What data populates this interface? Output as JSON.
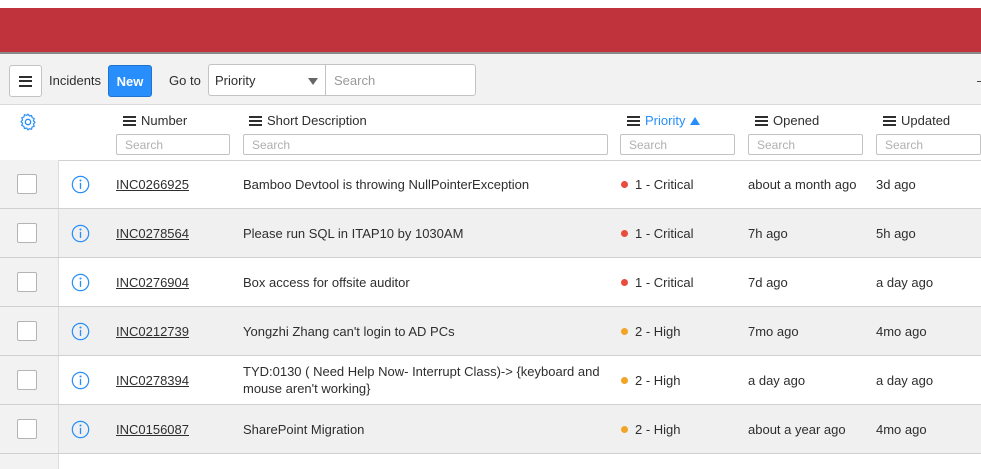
{
  "toolbar": {
    "title": "Incidents",
    "new_label": "New",
    "goto_label": "Go to",
    "goto_selected": "Priority",
    "search_placeholder": "Search"
  },
  "columns": {
    "number": "Number",
    "short_description": "Short Description",
    "priority": "Priority",
    "opened": "Opened",
    "updated": "Updated",
    "search_placeholder": "Search",
    "sorted_by": "Priority",
    "sort_direction": "ascending"
  },
  "colors": {
    "banner": "#c0333c",
    "accent": "#278efc",
    "critical": "#e84c3d",
    "high": "#f2a425"
  },
  "rows": [
    {
      "number": "INC0266925",
      "short_description": "Bamboo Devtool is throwing NullPointerException",
      "priority": "1 - Critical",
      "priority_level": "critical",
      "opened": "about a month ago",
      "updated": "3d ago"
    },
    {
      "number": "INC0278564",
      "short_description": "Please run SQL in ITAP10 by 1030AM",
      "priority": "1 - Critical",
      "priority_level": "critical",
      "opened": "7h ago",
      "updated": "5h ago"
    },
    {
      "number": "INC0276904",
      "short_description": "Box access for offsite auditor",
      "priority": "1 - Critical",
      "priority_level": "critical",
      "opened": "7d ago",
      "updated": "a day ago"
    },
    {
      "number": "INC0212739",
      "short_description": "Yongzhi Zhang can't login to AD PCs",
      "priority": "2 - High",
      "priority_level": "high",
      "opened": "7mo ago",
      "updated": "4mo ago"
    },
    {
      "number": "INC0278394",
      "short_description": "TYD:0130 ( Need Help Now- Interrupt Class)-> {keyboard and mouse aren't working}",
      "priority": "2 - High",
      "priority_level": "high",
      "opened": "a day ago",
      "updated": "a day ago"
    },
    {
      "number": "INC0156087",
      "short_description": "SharePoint Migration",
      "priority": "2 - High",
      "priority_level": "high",
      "opened": "about a year ago",
      "updated": "4mo ago"
    }
  ]
}
